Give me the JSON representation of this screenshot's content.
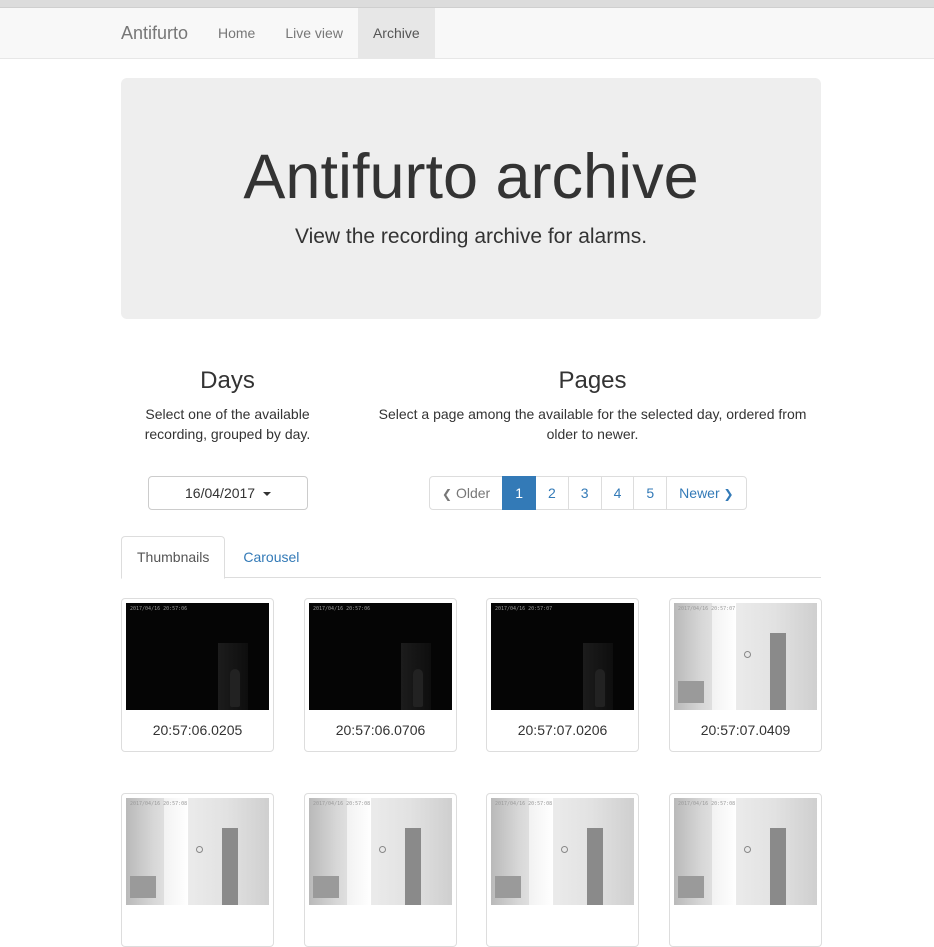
{
  "navbar": {
    "brand": "Antifurto",
    "links": [
      {
        "label": "Home",
        "active": false
      },
      {
        "label": "Live view",
        "active": false
      },
      {
        "label": "Archive",
        "active": true
      }
    ]
  },
  "jumbotron": {
    "title": "Antifurto archive",
    "subtitle": "View the recording archive for alarms."
  },
  "days": {
    "heading": "Days",
    "description": "Select one of the available recording, grouped by day.",
    "selected_day": "16/04/2017"
  },
  "pages": {
    "heading": "Pages",
    "description": "Select a page among the available for the selected day, ordered from older to newer.",
    "older_label": "Older",
    "newer_label": "Newer",
    "items": [
      "1",
      "2",
      "3",
      "4",
      "5"
    ],
    "active_page": "1"
  },
  "tabs": [
    {
      "label": "Thumbnails",
      "active": true
    },
    {
      "label": "Carousel",
      "active": false
    }
  ],
  "thumbnails": [
    {
      "caption": "20:57:06.0205",
      "tone": "dark",
      "stamp": "2017/04/16 20:57:06"
    },
    {
      "caption": "20:57:06.0706",
      "tone": "dark",
      "stamp": "2017/04/16 20:57:06"
    },
    {
      "caption": "20:57:07.0206",
      "tone": "dark",
      "stamp": "2017/04/16 20:57:07"
    },
    {
      "caption": "20:57:07.0409",
      "tone": "light",
      "stamp": "2017/04/16 20:57:07"
    },
    {
      "caption": "",
      "tone": "light",
      "stamp": "2017/04/16 20:57:08"
    },
    {
      "caption": "",
      "tone": "light",
      "stamp": "2017/04/16 20:57:08"
    },
    {
      "caption": "",
      "tone": "light",
      "stamp": "2017/04/16 20:57:08"
    },
    {
      "caption": "",
      "tone": "light",
      "stamp": "2017/04/16 20:57:08"
    }
  ],
  "colors": {
    "link": "#337ab7",
    "navbar_bg": "#f8f8f8",
    "jumbotron_bg": "#eeeeee"
  }
}
